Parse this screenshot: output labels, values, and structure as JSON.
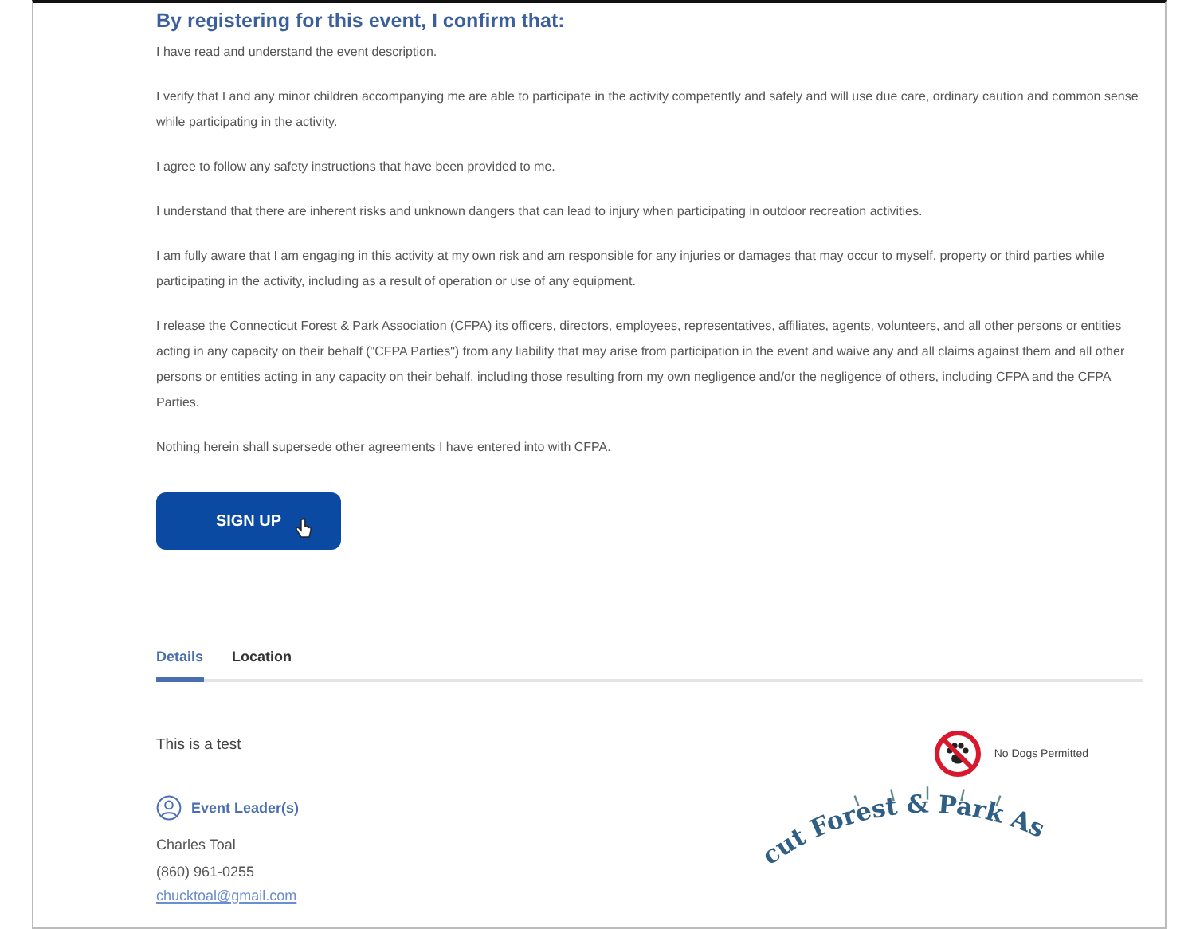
{
  "heading": "By registering for this event, I confirm that:",
  "paragraphs": [
    "I have read and understand the event description.",
    "I verify that I and any minor children accompanying me are able to participate in the activity competently and safely and will use due care, ordinary caution and common sense while participating in the activity.",
    "I agree to follow any safety instructions that have been provided to me.",
    "I understand that there are inherent risks and unknown dangers that can lead to injury when participating in outdoor recreation activities.",
    "I am fully aware that I am engaging in this activity at my own risk and am responsible for any injuries or damages that may occur to myself, property or third parties while participating in the activity, including as a result of operation or use of any equipment.",
    "I release the Connecticut Forest & Park Association (CFPA) its officers, directors, employees, representatives, affiliates, agents, volunteers, and all other persons or entities acting in any capacity on their behalf (\"CFPA Parties\") from any liability that may arise from participation in the event and waive any and all claims against them and all other persons or entities acting in any capacity on their behalf, including those resulting from my own negligence and/or the negligence of others, including CFPA and the CFPA Parties.",
    "Nothing herein shall supersede other agreements I have entered into with CFPA."
  ],
  "signup_button": "SIGN UP",
  "tabs": [
    {
      "label": "Details",
      "selected": true
    },
    {
      "label": "Location",
      "selected": false
    }
  ],
  "description": "This is a test",
  "amenity": "No Dogs Permitted",
  "leader_heading": "Event Leader(s)",
  "leader": {
    "name": "Charles Toal",
    "phone": "(860) 961-0255",
    "email": "chucktoal@gmail.com"
  },
  "logo_text": "cut Forest & Park As"
}
